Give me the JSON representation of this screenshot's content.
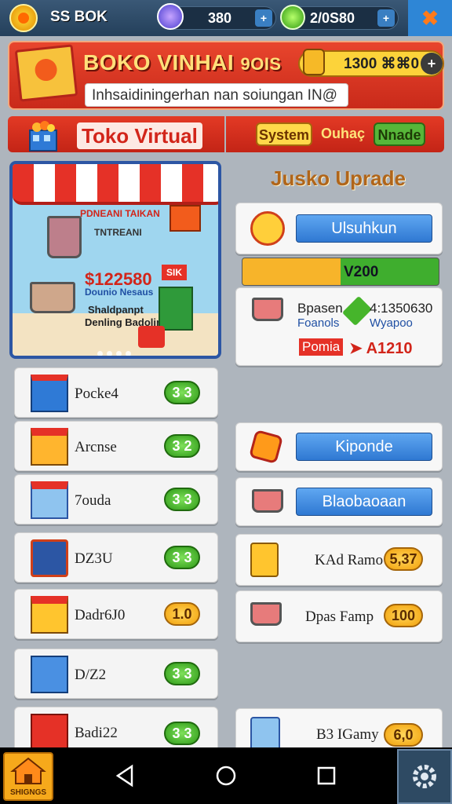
{
  "topbar": {
    "coins": "SS BOK",
    "resource1": "380",
    "resource2": "2/0S80",
    "plus_label": "+"
  },
  "banner": {
    "title": "BOKO VINHAI",
    "tag": "9OIS",
    "subtitle": "Inhsaidiningerhan nan soiungan IN@",
    "coin_value": "1300 ⌘⌘0",
    "plus_label": "+"
  },
  "shop": {
    "title": "Toko Virtual",
    "tabs": [
      {
        "label": "System",
        "color": "#ffd84a"
      },
      {
        "label": "Ouhaç",
        "color": "#ffe37a"
      },
      {
        "label": "Nnade",
        "color": "#57b639"
      }
    ]
  },
  "promo": {
    "line1": "PDNEANI TAIKAN",
    "line2": "TNTREANI",
    "price": "$122580",
    "line3": "Dounio Nesaus",
    "line4": "Shaldpanpt",
    "line5": "Denling Badolin",
    "tag": "SIK"
  },
  "upgrade": {
    "title": "Jusko Uprade",
    "button1": "Ulsuhkun",
    "progress_value": "V200",
    "progress_fraction": 0.5,
    "info_label1": "Bpasen",
    "info_label2": "Foanols",
    "info_value1": "4:1350630",
    "info_value2": "Wyapoo",
    "info_red_label": "Pomia",
    "info_red_value": "A1210",
    "button2": "Kiponde",
    "button3": "Blaobaoaan",
    "rows": [
      {
        "label": "KAd Ramo",
        "price": "5,37"
      },
      {
        "label": "Dpas Famp",
        "price": "100"
      },
      {
        "label": "B3 IGamy",
        "price": "6,0"
      }
    ]
  },
  "items": [
    {
      "label": "Pocke4",
      "price": "3 3",
      "pill": "green"
    },
    {
      "label": "Arcnse",
      "price": "3 2",
      "pill": "green"
    },
    {
      "label": "7ouda",
      "price": "3 3",
      "pill": "green"
    },
    {
      "label": "DZ3U",
      "price": "3 3",
      "pill": "green"
    },
    {
      "label": "Dadr6J0",
      "price": "1.0",
      "pill": "yellow"
    },
    {
      "label": "D/Z2",
      "price": "3 3",
      "pill": "green"
    },
    {
      "label": "Badi22",
      "price": "3 3",
      "pill": "green"
    }
  ],
  "nav": {
    "home_label": "SHIGNGS"
  }
}
